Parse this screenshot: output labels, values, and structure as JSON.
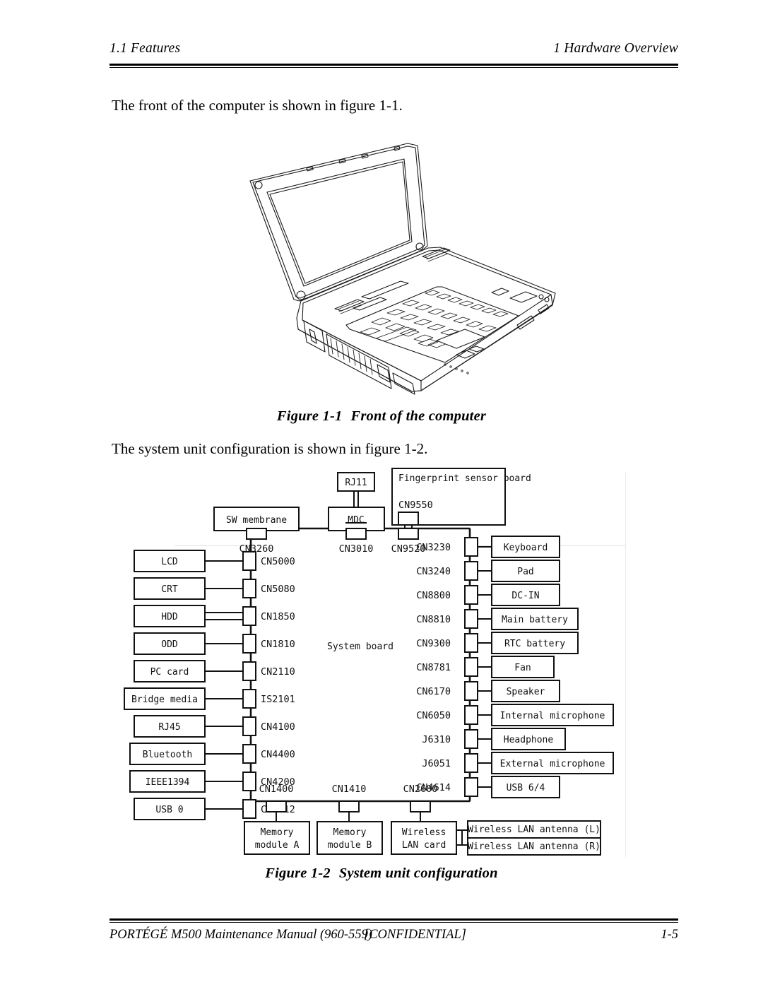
{
  "header": {
    "left": "1.1 Features",
    "right": "1  Hardware Overview"
  },
  "body": {
    "paragraph_1": "The front of the computer is shown in figure 1-1.",
    "paragraph_2": "The system unit configuration is shown in figure 1-2."
  },
  "figures": {
    "figure_1_1": {
      "number": "Figure 1-1",
      "title": "Front of the computer"
    },
    "figure_1_2": {
      "number": "Figure 1-2",
      "title": "System unit configuration"
    }
  },
  "diagram": {
    "center_label": "System board",
    "top_modules": [
      {
        "label": "SW membrane",
        "connector": "CN3260"
      },
      {
        "label": "MDC",
        "connector": "CN3010"
      },
      {
        "label": "Fingerprint sensor board",
        "connector": "CN9520",
        "board_connector": "CN9550"
      }
    ],
    "top_sub_modules": [
      {
        "label": "RJ11",
        "parent": "MDC"
      }
    ],
    "left_modules": [
      {
        "label": "LCD",
        "connector": "CN5000"
      },
      {
        "label": "CRT",
        "connector": "CN5080"
      },
      {
        "label": "HDD",
        "connector": "CN1850"
      },
      {
        "label": "ODD",
        "connector": "CN1810"
      },
      {
        "label": "PC card",
        "connector": "CN2110"
      },
      {
        "label": "Bridge media",
        "connector": "IS2101"
      },
      {
        "label": "RJ45",
        "connector": "CN4100"
      },
      {
        "label": "Bluetooth",
        "connector": "CN4400"
      },
      {
        "label": "IEEE1394",
        "connector": "CN4200"
      },
      {
        "label": "USB 0",
        "connector": "CN4612"
      }
    ],
    "right_modules": [
      {
        "label": "Keyboard",
        "connector": "CN3230"
      },
      {
        "label": "Pad",
        "connector": "CN3240"
      },
      {
        "label": "DC-IN",
        "connector": "CN8800"
      },
      {
        "label": "Main battery",
        "connector": "CN8810"
      },
      {
        "label": "RTC battery",
        "connector": "CN9300"
      },
      {
        "label": "Fan",
        "connector": "CN8781"
      },
      {
        "label": "Speaker",
        "connector": "CN6170"
      },
      {
        "label": "Internal microphone",
        "connector": "CN6050"
      },
      {
        "label": "Headphone",
        "connector": "J6310"
      },
      {
        "label": "External microphone",
        "connector": "J6051"
      },
      {
        "label": "USB 6/4",
        "connector": "CN4614"
      }
    ],
    "bottom_modules": [
      {
        "label_line1": "Memory",
        "label_line2": "module A",
        "connector": "CN1400"
      },
      {
        "label_line1": "Memory",
        "label_line2": "module B",
        "connector": "CN1410"
      },
      {
        "label_line1": "Wireless",
        "label_line2": "LAN card",
        "connector": "CN2600"
      }
    ],
    "bottom_sub_modules": [
      {
        "label": "Wireless LAN antenna (L)",
        "parent": "LAN card"
      },
      {
        "label": "Wireless LAN antenna (R)",
        "parent": "LAN card"
      }
    ]
  },
  "footer": {
    "left": "PORTÉGÉ M500 Maintenance Manual (960-559)",
    "center": "[CONFIDENTIAL]",
    "right": "1-5"
  }
}
